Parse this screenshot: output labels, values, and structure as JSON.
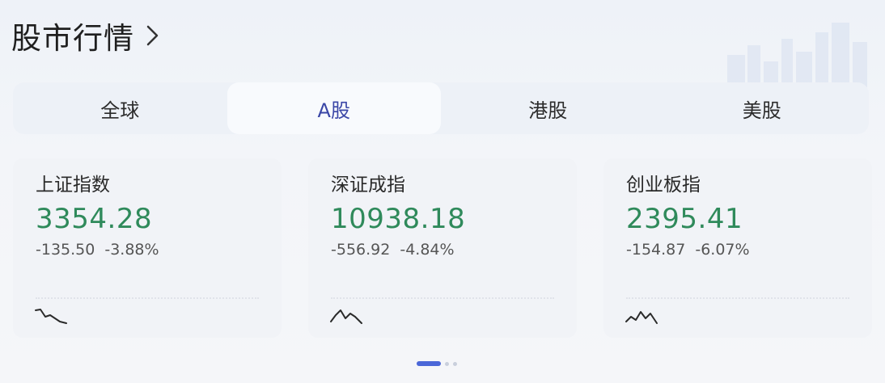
{
  "header": {
    "title": "股市行情"
  },
  "tabs": [
    {
      "label": "全球",
      "active": false
    },
    {
      "label": "A股",
      "active": true
    },
    {
      "label": "港股",
      "active": false
    },
    {
      "label": "美股",
      "active": false
    }
  ],
  "cards": [
    {
      "name": "上证指数",
      "price": "3354.28",
      "change": "-135.50",
      "percent": "-3.88%"
    },
    {
      "name": "深证成指",
      "price": "10938.18",
      "change": "-556.92",
      "percent": "-4.84%"
    },
    {
      "name": "创业板指",
      "price": "2395.41",
      "change": "-154.87",
      "percent": "-6.07%"
    }
  ],
  "pager": {
    "pages": 3,
    "current": 1
  },
  "colors": {
    "accent": "#3a46a6",
    "down": "#2f8a5b",
    "pager_active": "#4b67d8"
  }
}
